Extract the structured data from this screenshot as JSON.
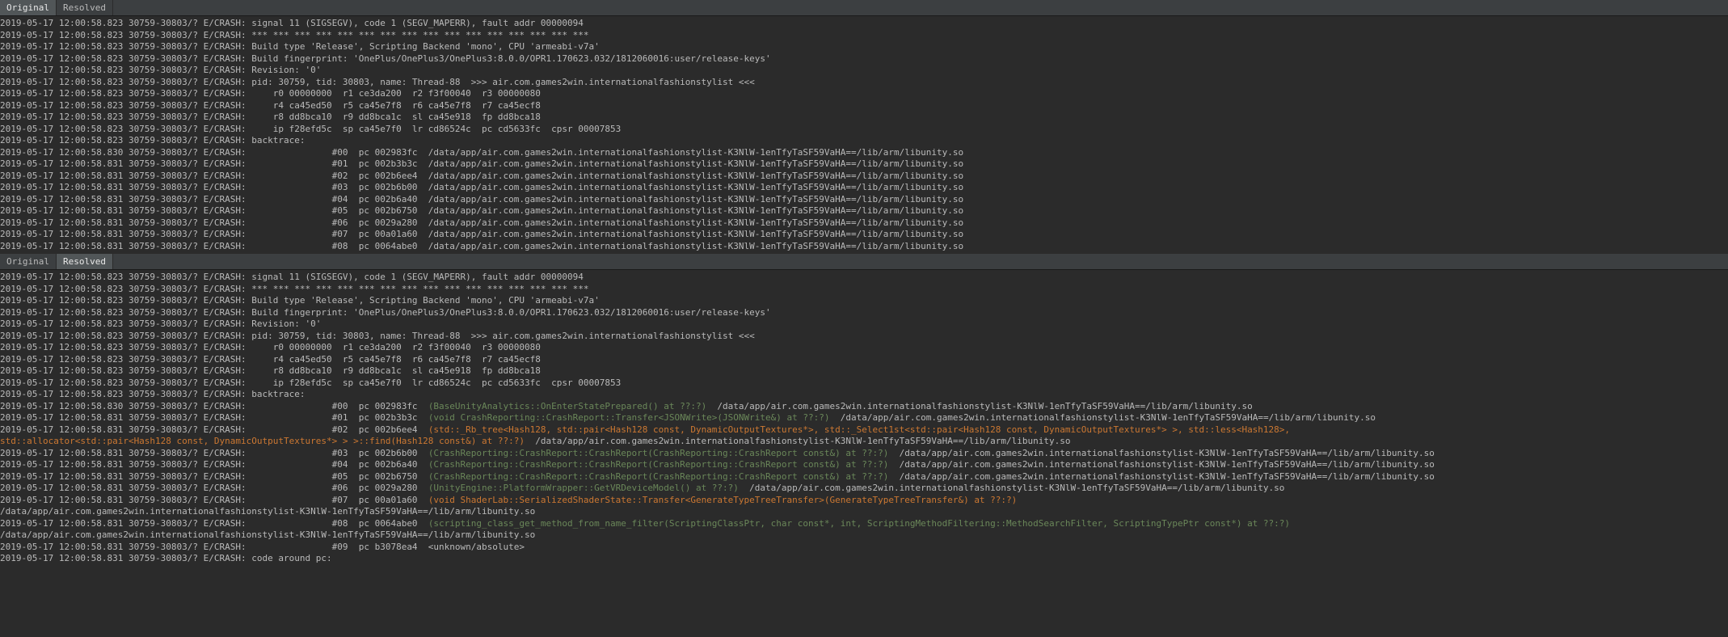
{
  "tabs": {
    "original": "Original",
    "resolved": "Resolved"
  },
  "pane1": {
    "activeTab": "original",
    "lines": [
      "2019-05-17 12:00:58.823 30759-30803/? E/CRASH: signal 11 (SIGSEGV), code 1 (SEGV_MAPERR), fault addr 00000094",
      "2019-05-17 12:00:58.823 30759-30803/? E/CRASH: *** *** *** *** *** *** *** *** *** *** *** *** *** *** *** ***",
      "2019-05-17 12:00:58.823 30759-30803/? E/CRASH: Build type 'Release', Scripting Backend 'mono', CPU 'armeabi-v7a'",
      "2019-05-17 12:00:58.823 30759-30803/? E/CRASH: Build fingerprint: 'OnePlus/OnePlus3/OnePlus3:8.0.0/OPR1.170623.032/1812060016:user/release-keys'",
      "2019-05-17 12:00:58.823 30759-30803/? E/CRASH: Revision: '0'",
      "2019-05-17 12:00:58.823 30759-30803/? E/CRASH: pid: 30759, tid: 30803, name: Thread-88  >>> air.com.games2win.internationalfashionstylist <<<",
      "2019-05-17 12:00:58.823 30759-30803/? E/CRASH:     r0 00000000  r1 ce3da200  r2 f3f00040  r3 00000080",
      "2019-05-17 12:00:58.823 30759-30803/? E/CRASH:     r4 ca45ed50  r5 ca45e7f8  r6 ca45e7f8  r7 ca45ecf8",
      "2019-05-17 12:00:58.823 30759-30803/? E/CRASH:     r8 dd8bca10  r9 dd8bca1c  sl ca45e918  fp dd8bca18",
      "2019-05-17 12:00:58.823 30759-30803/? E/CRASH:     ip f28efd5c  sp ca45e7f0  lr cd86524c  pc cd5633fc  cpsr 00007853",
      "2019-05-17 12:00:58.823 30759-30803/? E/CRASH: backtrace:",
      "2019-05-17 12:00:58.830 30759-30803/? E/CRASH:                #00  pc 002983fc  /data/app/air.com.games2win.internationalfashionstylist-K3NlW-1enTfyTaSF59VaHA==/lib/arm/libunity.so",
      "2019-05-17 12:00:58.831 30759-30803/? E/CRASH:                #01  pc 002b3b3c  /data/app/air.com.games2win.internationalfashionstylist-K3NlW-1enTfyTaSF59VaHA==/lib/arm/libunity.so",
      "2019-05-17 12:00:58.831 30759-30803/? E/CRASH:                #02  pc 002b6ee4  /data/app/air.com.games2win.internationalfashionstylist-K3NlW-1enTfyTaSF59VaHA==/lib/arm/libunity.so",
      "2019-05-17 12:00:58.831 30759-30803/? E/CRASH:                #03  pc 002b6b00  /data/app/air.com.games2win.internationalfashionstylist-K3NlW-1enTfyTaSF59VaHA==/lib/arm/libunity.so",
      "2019-05-17 12:00:58.831 30759-30803/? E/CRASH:                #04  pc 002b6a40  /data/app/air.com.games2win.internationalfashionstylist-K3NlW-1enTfyTaSF59VaHA==/lib/arm/libunity.so",
      "2019-05-17 12:00:58.831 30759-30803/? E/CRASH:                #05  pc 002b6750  /data/app/air.com.games2win.internationalfashionstylist-K3NlW-1enTfyTaSF59VaHA==/lib/arm/libunity.so",
      "2019-05-17 12:00:58.831 30759-30803/? E/CRASH:                #06  pc 0029a280  /data/app/air.com.games2win.internationalfashionstylist-K3NlW-1enTfyTaSF59VaHA==/lib/arm/libunity.so",
      "2019-05-17 12:00:58.831 30759-30803/? E/CRASH:                #07  pc 00a01a60  /data/app/air.com.games2win.internationalfashionstylist-K3NlW-1enTfyTaSF59VaHA==/lib/arm/libunity.so",
      "2019-05-17 12:00:58.831 30759-30803/? E/CRASH:                #08  pc 0064abe0  /data/app/air.com.games2win.internationalfashionstylist-K3NlW-1enTfyTaSF59VaHA==/lib/arm/libunity.so"
    ]
  },
  "pane2": {
    "activeTab": "resolved",
    "lines": [
      {
        "segments": [
          {
            "t": "2019-05-17 12:00:58.823 30759-30803/? E/CRASH: signal 11 (SIGSEGV), code 1 (SEGV_MAPERR), fault addr 00000094",
            "c": ""
          }
        ]
      },
      {
        "segments": [
          {
            "t": "2019-05-17 12:00:58.823 30759-30803/? E/CRASH: *** *** *** *** *** *** *** *** *** *** *** *** *** *** *** ***",
            "c": ""
          }
        ]
      },
      {
        "segments": [
          {
            "t": "2019-05-17 12:00:58.823 30759-30803/? E/CRASH: Build type 'Release', Scripting Backend 'mono', CPU 'armeabi-v7a'",
            "c": ""
          }
        ]
      },
      {
        "segments": [
          {
            "t": "2019-05-17 12:00:58.823 30759-30803/? E/CRASH: Build fingerprint: 'OnePlus/OnePlus3/OnePlus3:8.0.0/OPR1.170623.032/1812060016:user/release-keys'",
            "c": ""
          }
        ]
      },
      {
        "segments": [
          {
            "t": "2019-05-17 12:00:58.823 30759-30803/? E/CRASH: Revision: '0'",
            "c": ""
          }
        ]
      },
      {
        "segments": [
          {
            "t": "2019-05-17 12:00:58.823 30759-30803/? E/CRASH: pid: 30759, tid: 30803, name: Thread-88  >>> air.com.games2win.internationalfashionstylist <<<",
            "c": ""
          }
        ]
      },
      {
        "segments": [
          {
            "t": "2019-05-17 12:00:58.823 30759-30803/? E/CRASH:     r0 00000000  r1 ce3da200  r2 f3f00040  r3 00000080",
            "c": ""
          }
        ]
      },
      {
        "segments": [
          {
            "t": "2019-05-17 12:00:58.823 30759-30803/? E/CRASH:     r4 ca45ed50  r5 ca45e7f8  r6 ca45e7f8  r7 ca45ecf8",
            "c": ""
          }
        ]
      },
      {
        "segments": [
          {
            "t": "2019-05-17 12:00:58.823 30759-30803/? E/CRASH:     r8 dd8bca10  r9 dd8bca1c  sl ca45e918  fp dd8bca18",
            "c": ""
          }
        ]
      },
      {
        "segments": [
          {
            "t": "2019-05-17 12:00:58.823 30759-30803/? E/CRASH:     ip f28efd5c  sp ca45e7f0  lr cd86524c  pc cd5633fc  cpsr 00007853",
            "c": ""
          }
        ]
      },
      {
        "segments": [
          {
            "t": "2019-05-17 12:00:58.823 30759-30803/? E/CRASH: backtrace:",
            "c": ""
          }
        ]
      },
      {
        "segments": [
          {
            "t": "2019-05-17 12:00:58.830 30759-30803/? E/CRASH:                #00  pc 002983fc  ",
            "c": ""
          },
          {
            "t": "(BaseUnityAnalytics::OnEnterStatePrepared() at ??:?)",
            "c": "green"
          },
          {
            "t": "  /data/app/air.com.games2win.internationalfashionstylist-K3NlW-1enTfyTaSF59VaHA==/lib/arm/libunity.so",
            "c": ""
          }
        ]
      },
      {
        "segments": [
          {
            "t": "2019-05-17 12:00:58.831 30759-30803/? E/CRASH:                #01  pc 002b3b3c  ",
            "c": ""
          },
          {
            "t": "(void CrashReporting::CrashReport::Transfer<JSONWrite>(JSONWrite&) at ??:?)",
            "c": "green"
          },
          {
            "t": "  /data/app/air.com.games2win.internationalfashionstylist-K3NlW-1enTfyTaSF59VaHA==/lib/arm/libunity.so",
            "c": ""
          }
        ]
      },
      {
        "segments": [
          {
            "t": "2019-05-17 12:00:58.831 30759-30803/? E/CRASH:                #02  pc 002b6ee4  ",
            "c": ""
          },
          {
            "t": "(std::_Rb_tree<Hash128, std::pair<Hash128 const, DynamicOutputTextures*>, std::_Select1st<std::pair<Hash128 const, DynamicOutputTextures*> >, std::less<Hash128>,",
            "c": "yellow"
          }
        ]
      },
      {
        "segments": [
          {
            "t": "std::allocator<std::pair<Hash128 const, DynamicOutputTextures*> > >::find(Hash128 const&) at ??:?)",
            "c": "yellow"
          },
          {
            "t": "  /data/app/air.com.games2win.internationalfashionstylist-K3NlW-1enTfyTaSF59VaHA==/lib/arm/libunity.so",
            "c": ""
          }
        ]
      },
      {
        "segments": [
          {
            "t": "2019-05-17 12:00:58.831 30759-30803/? E/CRASH:                #03  pc 002b6b00  ",
            "c": ""
          },
          {
            "t": "(CrashReporting::CrashReport::CrashReport(CrashReporting::CrashReport const&) at ??:?)",
            "c": "green"
          },
          {
            "t": "  /data/app/air.com.games2win.internationalfashionstylist-K3NlW-1enTfyTaSF59VaHA==/lib/arm/libunity.so",
            "c": ""
          }
        ]
      },
      {
        "segments": [
          {
            "t": "2019-05-17 12:00:58.831 30759-30803/? E/CRASH:                #04  pc 002b6a40  ",
            "c": ""
          },
          {
            "t": "(CrashReporting::CrashReport::CrashReport(CrashReporting::CrashReport const&) at ??:?)",
            "c": "green"
          },
          {
            "t": "  /data/app/air.com.games2win.internationalfashionstylist-K3NlW-1enTfyTaSF59VaHA==/lib/arm/libunity.so",
            "c": ""
          }
        ]
      },
      {
        "segments": [
          {
            "t": "2019-05-17 12:00:58.831 30759-30803/? E/CRASH:                #05  pc 002b6750  ",
            "c": ""
          },
          {
            "t": "(CrashReporting::CrashReport::CrashReport(CrashReporting::CrashReport const&) at ??:?)",
            "c": "green"
          },
          {
            "t": "  /data/app/air.com.games2win.internationalfashionstylist-K3NlW-1enTfyTaSF59VaHA==/lib/arm/libunity.so",
            "c": ""
          }
        ]
      },
      {
        "segments": [
          {
            "t": "2019-05-17 12:00:58.831 30759-30803/? E/CRASH:                #06  pc 0029a280  ",
            "c": ""
          },
          {
            "t": "(UnityEngine::PlatformWrapper::GetVRDeviceModel() at ??:?)",
            "c": "green"
          },
          {
            "t": "  /data/app/air.com.games2win.internationalfashionstylist-K3NlW-1enTfyTaSF59VaHA==/lib/arm/libunity.so",
            "c": ""
          }
        ]
      },
      {
        "segments": [
          {
            "t": "2019-05-17 12:00:58.831 30759-30803/? E/CRASH:                #07  pc 00a01a60  ",
            "c": ""
          },
          {
            "t": "(void ShaderLab::SerializedShaderState::Transfer<GenerateTypeTreeTransfer>(GenerateTypeTreeTransfer&) at ??:?)",
            "c": "yellow"
          }
        ]
      },
      {
        "segments": [
          {
            "t": "/data/app/air.com.games2win.internationalfashionstylist-K3NlW-1enTfyTaSF59VaHA==/lib/arm/libunity.so",
            "c": ""
          }
        ]
      },
      {
        "segments": [
          {
            "t": "2019-05-17 12:00:58.831 30759-30803/? E/CRASH:                #08  pc 0064abe0  ",
            "c": ""
          },
          {
            "t": "(scripting_class_get_method_from_name_filter(ScriptingClassPtr, char const*, int, ScriptingMethodFiltering::MethodSearchFilter, ScriptingTypePtr const*) at ??:?)",
            "c": "green"
          }
        ]
      },
      {
        "segments": [
          {
            "t": "/data/app/air.com.games2win.internationalfashionstylist-K3NlW-1enTfyTaSF59VaHA==/lib/arm/libunity.so",
            "c": ""
          }
        ]
      },
      {
        "segments": [
          {
            "t": "2019-05-17 12:00:58.831 30759-30803/? E/CRASH:                #09  pc b3078ea4  <unknown/absolute>",
            "c": ""
          }
        ]
      },
      {
        "segments": [
          {
            "t": "2019-05-17 12:00:58.831 30759-30803/? E/CRASH: code around pc:",
            "c": ""
          }
        ]
      }
    ]
  }
}
